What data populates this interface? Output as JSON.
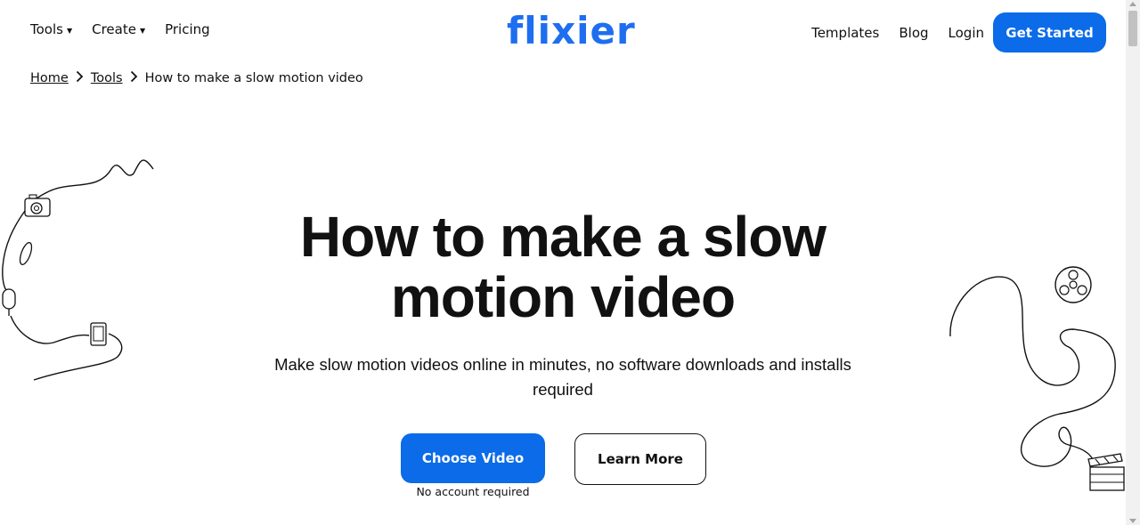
{
  "nav": {
    "tools_label": "Tools",
    "create_label": "Create",
    "pricing_label": "Pricing",
    "logo_text": "flixier",
    "templates_label": "Templates",
    "blog_label": "Blog",
    "login_label": "Login",
    "get_started_label": "Get Started"
  },
  "breadcrumb": {
    "home": "Home",
    "tools": "Tools",
    "current": "How to make a slow motion video"
  },
  "hero": {
    "title": "How to make a slow motion video",
    "subtitle": "Make slow motion videos online in minutes, no software downloads and installs required",
    "choose_video_label": "Choose Video",
    "learn_more_label": "Learn More",
    "note": "No account required"
  },
  "colors": {
    "brand_blue": "#0b6be8",
    "logo_blue": "#1e6ef0",
    "text": "#111111"
  },
  "icons": [
    "caret-down-icon",
    "chevron-right-icon",
    "camera-icon",
    "microphone-icon",
    "phone-icon",
    "film-reel-icon",
    "clapperboard-icon"
  ]
}
